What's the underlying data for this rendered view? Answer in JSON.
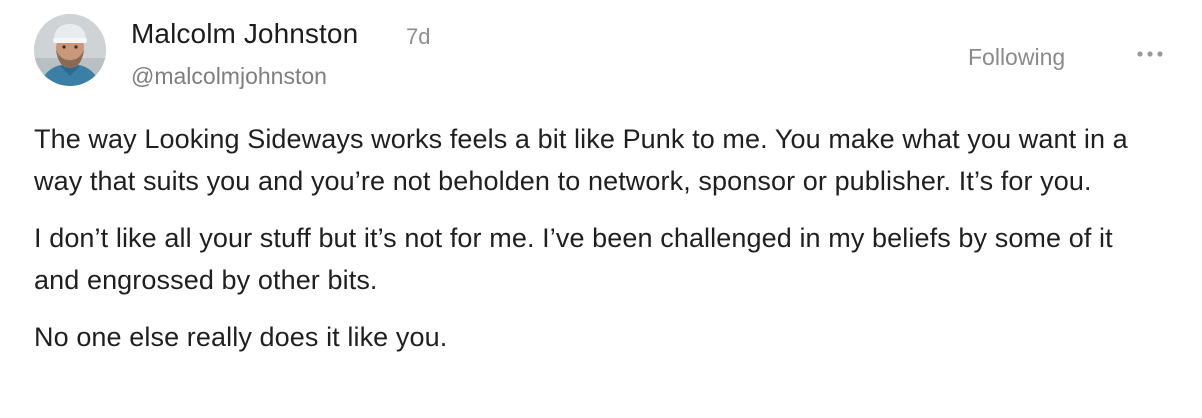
{
  "author": {
    "name": "Malcolm Johnston",
    "handle": "@malcolmjohnston",
    "time": "7d",
    "avatar_icon": "user-avatar"
  },
  "actions": {
    "follow_label": "Following",
    "more_icon": "ellipsis-icon"
  },
  "post": {
    "paragraphs": [
      "The way Looking Sideways works feels a bit like Punk to me. You make what you want in a way that suits you and you’re not beholden to network, sponsor or publisher. It’s for you.",
      "I don’t like all your stuff but it’s not for me. I’ve been challenged in my beliefs by some of it and engrossed by other bits.",
      "No one else really does it like you."
    ]
  },
  "colors": {
    "text": "#1f1f1f",
    "muted": "#8a8a8a",
    "background": "#ffffff"
  }
}
